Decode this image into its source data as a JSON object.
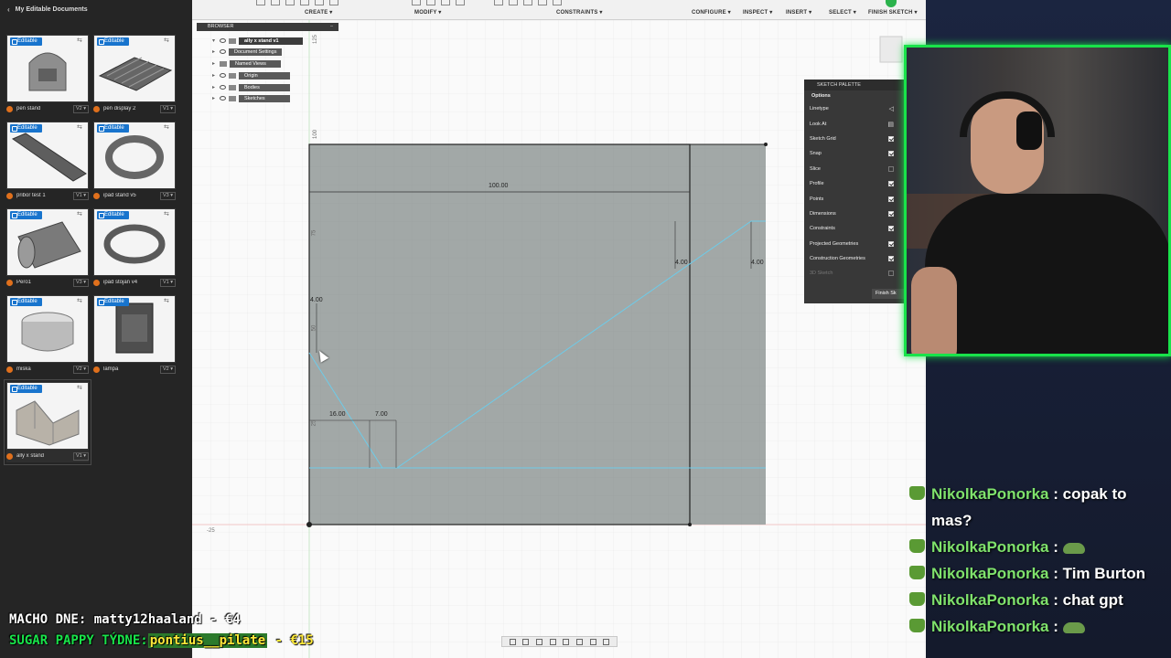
{
  "left_panel": {
    "title": "My Editable Documents",
    "documents": [
      {
        "name": "pen stand",
        "version": "V2 ▾",
        "badge": "Editable"
      },
      {
        "name": "pen display 2",
        "version": "V1 ▾",
        "badge": "Editable"
      },
      {
        "name": "pribor test 1",
        "version": "V1 ▾",
        "badge": "Editable"
      },
      {
        "name": "ipad stand v5",
        "version": "V3 ▾",
        "badge": "Editable"
      },
      {
        "name": "Pero1",
        "version": "V3 ▾",
        "badge": "Editable"
      },
      {
        "name": "ipad stojan v4",
        "version": "V1 ▾",
        "badge": "Editable"
      },
      {
        "name": "miska",
        "version": "V2 ▾",
        "badge": "Editable"
      },
      {
        "name": "lampa",
        "version": "V2 ▾",
        "badge": "Editable"
      },
      {
        "name": "ally x stand",
        "version": "V1 ▾",
        "badge": "Editable"
      }
    ]
  },
  "toolbar": {
    "groups": [
      "CREATE ▾",
      "MODIFY ▾",
      "CONSTRAINTS ▾",
      "CONFIGURE ▾",
      "INSPECT ▾",
      "INSERT ▾",
      "SELECT ▾",
      "FINISH SKETCH ▾"
    ]
  },
  "browser": {
    "title": "BROWSER",
    "root": "ally x stand v1",
    "items": [
      "Document Settings",
      "Named Views",
      "Origin",
      "Bodies",
      "Sketches"
    ]
  },
  "sketch": {
    "dimensions": {
      "width_top": "100.00",
      "right_a": "4.00",
      "right_b": "4.00",
      "left_small": "4.00",
      "bottom_a": "16.00",
      "bottom_b": "7.00"
    },
    "ruler_labels": [
      "125",
      "100",
      "75",
      "50",
      "25",
      "-25"
    ]
  },
  "palette": {
    "title": "SKETCH PALETTE",
    "section": "Options",
    "rows": [
      {
        "label": "Linetype",
        "state": "icon"
      },
      {
        "label": "Look At",
        "state": "icon"
      },
      {
        "label": "Sketch Grid",
        "state": "on"
      },
      {
        "label": "Snap",
        "state": "on"
      },
      {
        "label": "Slice",
        "state": "off"
      },
      {
        "label": "Profile",
        "state": "on"
      },
      {
        "label": "Points",
        "state": "on"
      },
      {
        "label": "Dimensions",
        "state": "on"
      },
      {
        "label": "Constraints",
        "state": "on"
      },
      {
        "label": "Projected Geometries",
        "state": "on"
      },
      {
        "label": "Construction Geometries",
        "state": "on"
      },
      {
        "label": "3D Sketch",
        "state": "off"
      }
    ],
    "finish": "Finish Sk"
  },
  "chat": {
    "messages": [
      {
        "user": "NikolkaPonorka",
        "text": ": copak to mas?",
        "emote": false
      },
      {
        "user": "NikolkaPonorka",
        "text": ":",
        "emote": true
      },
      {
        "user": "NikolkaPonorka",
        "text": ": Tim Burton",
        "emote": false
      },
      {
        "user": "NikolkaPonorka",
        "text": ": chat gpt",
        "emote": false
      },
      {
        "user": "NikolkaPonorka",
        "text": ":",
        "emote": true
      }
    ]
  },
  "overlay": {
    "line1": "MACHO DNE: matty12haaland - €4",
    "line2_prefix": "SUGAR PAPPY TÝDNE:",
    "line2_name": "pontius__pilate",
    "line2_amount": "- €15"
  },
  "colors": {
    "accent_green": "#19e34a",
    "sketch_fill": "#a2a8a7",
    "sketch_line": "#6ecbe8",
    "badge_blue": "#1874cd"
  }
}
